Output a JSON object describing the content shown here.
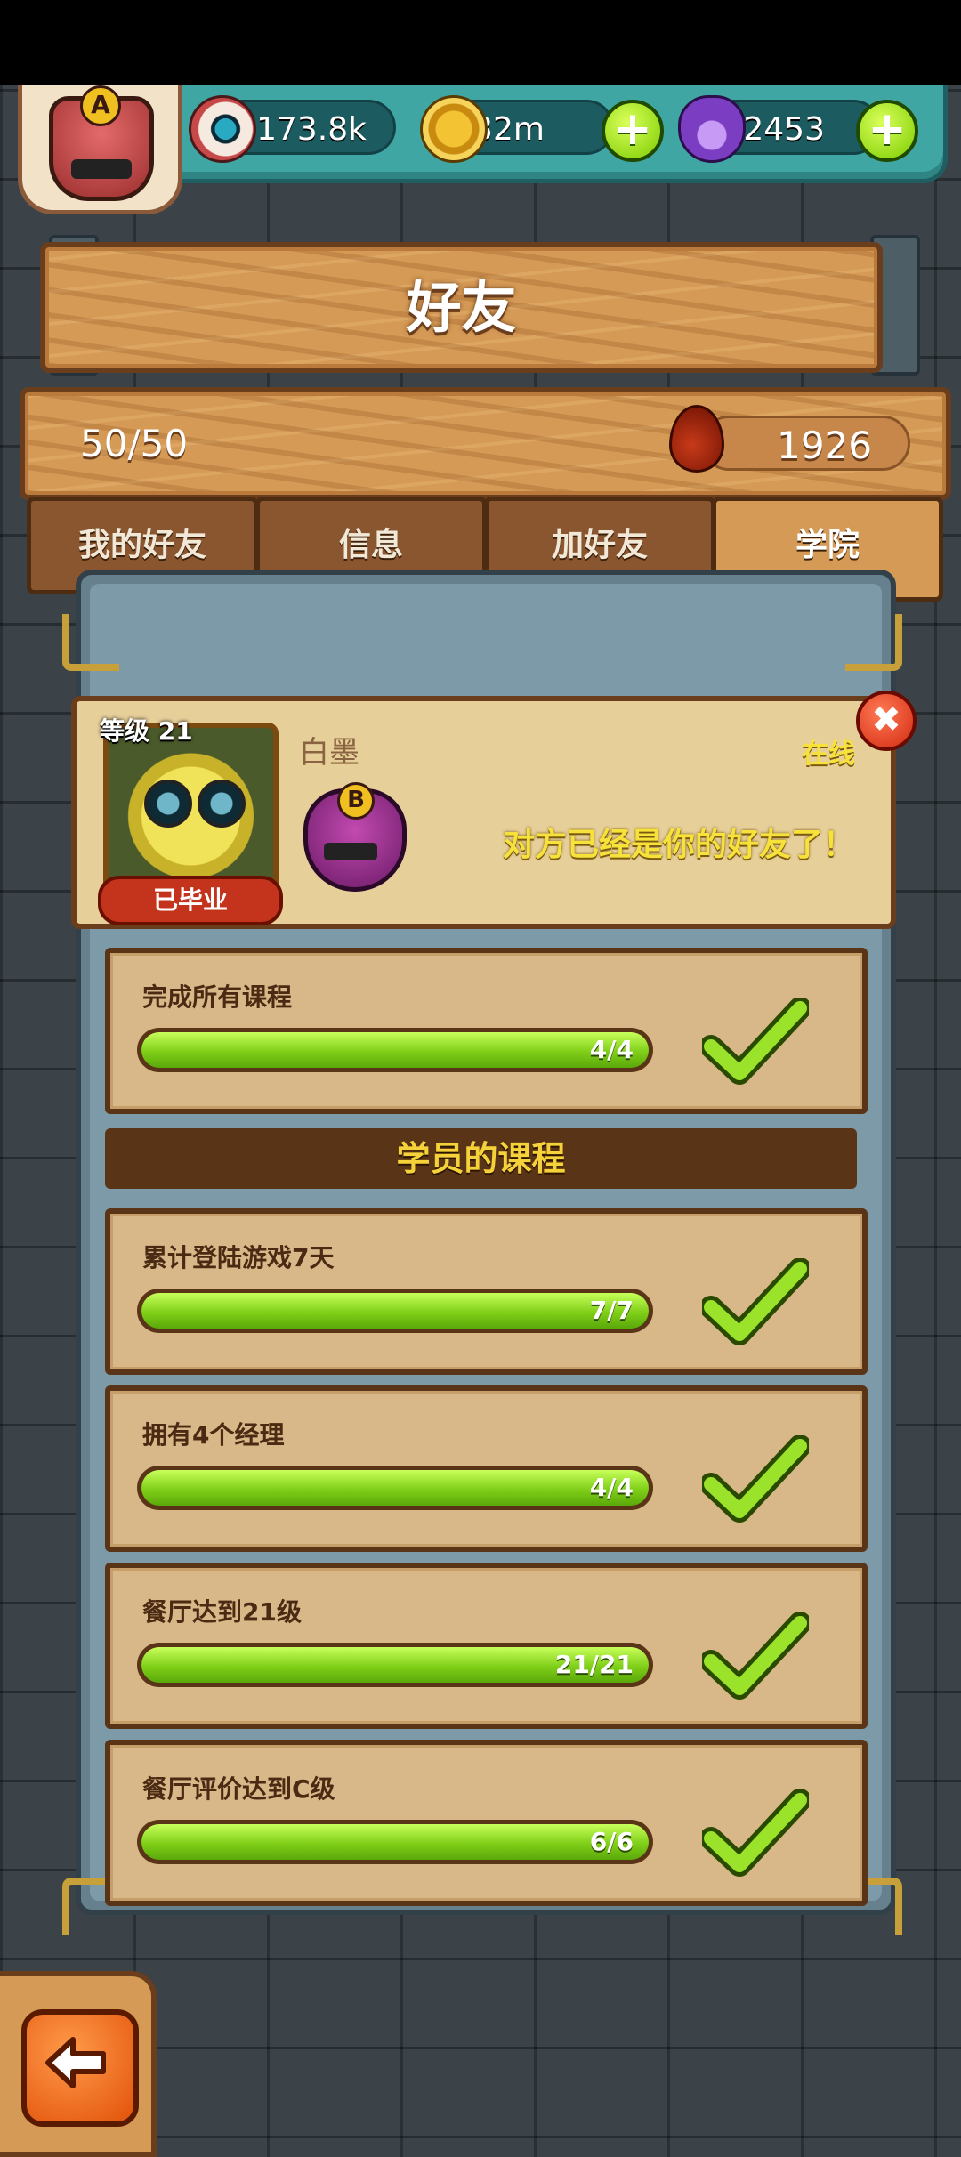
{
  "resources": {
    "eyes": "173.8k",
    "coins": "32m",
    "potions": "2453",
    "avatar_rank": "A"
  },
  "header": {
    "title": "好友"
  },
  "stats": {
    "friend_count": "50/50",
    "blood": "1926"
  },
  "tabs": [
    "我的好友",
    "信息",
    "加好友",
    "学院"
  ],
  "active_tab": "学院",
  "friend": {
    "level": "等级 21",
    "name": "白墨",
    "status": "在线",
    "graduated_label": "已毕业",
    "rank": "B",
    "message": "对方已经是你的好友了！"
  },
  "overall_course": {
    "title": "完成所有课程",
    "progress": "4/4",
    "fraction": 1
  },
  "section_title": "学员的课程",
  "courses": [
    {
      "title": "累计登陆游戏7天",
      "progress": "7/7",
      "fraction": 1
    },
    {
      "title": "拥有4个经理",
      "progress": "4/4",
      "fraction": 1
    },
    {
      "title": "餐厅达到21级",
      "progress": "21/21",
      "fraction": 1
    },
    {
      "title": "餐厅评价达到C级",
      "progress": "6/6",
      "fraction": 1
    }
  ],
  "colors": {
    "accent_green": "#7fcf18",
    "title_yellow": "#f6d23a",
    "wood": "#d59a55"
  }
}
